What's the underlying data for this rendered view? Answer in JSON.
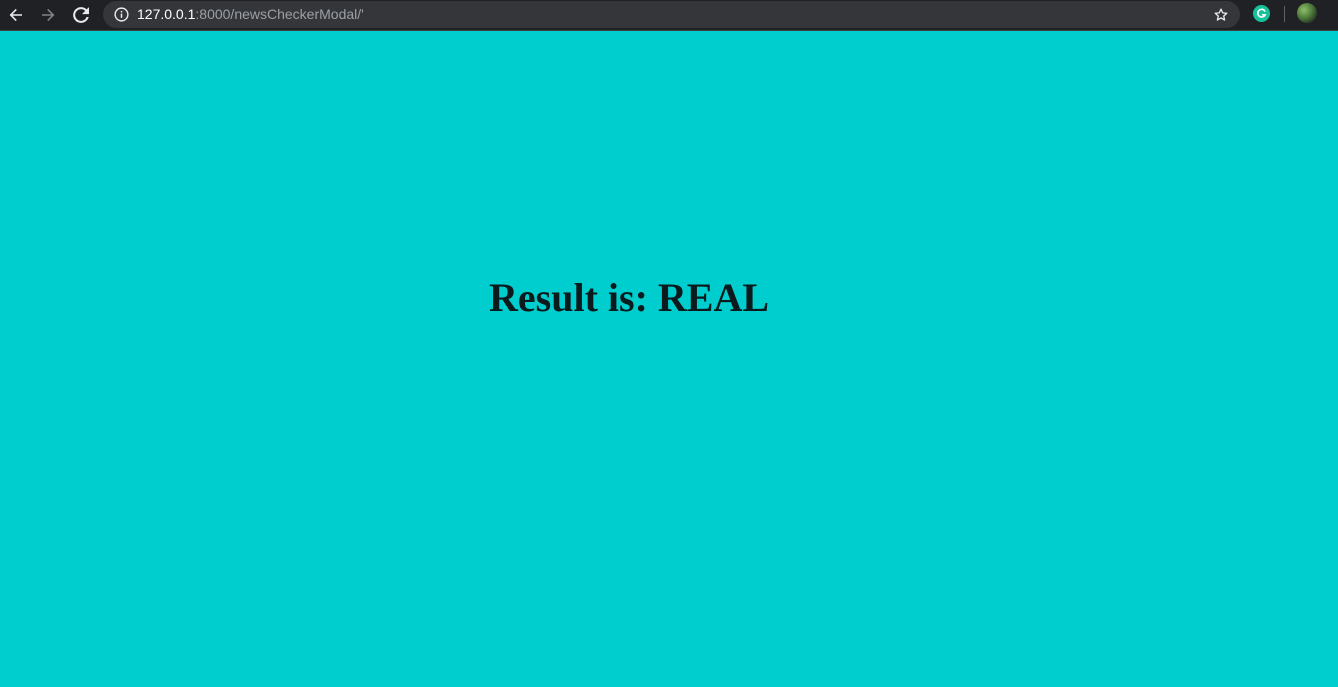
{
  "browser": {
    "url_host": "127.0.0.1",
    "url_path": ":8000/newsCheckerModal/'",
    "icons": {
      "back": "arrow-left-icon",
      "forward": "arrow-right-icon",
      "reload": "reload-icon",
      "site_info": "info-icon",
      "bookmark": "star-icon",
      "extension": "grammarly-icon",
      "profile": "avatar"
    }
  },
  "page": {
    "background_color": "#00cdcd",
    "result_label": "Result is: REAL"
  }
}
